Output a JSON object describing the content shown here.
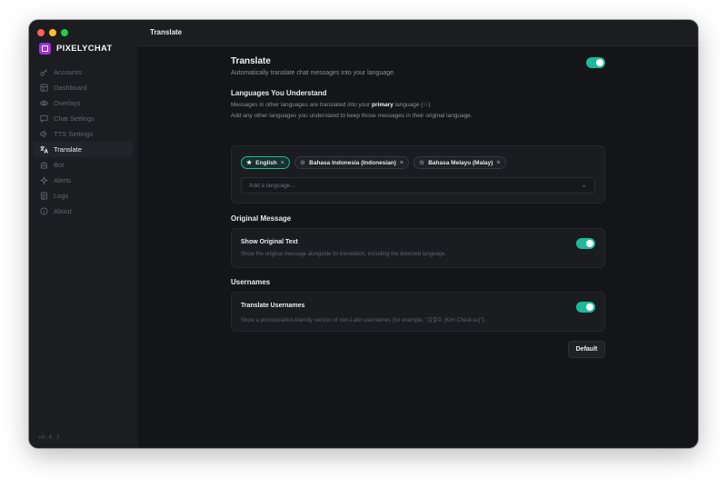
{
  "topbar": {
    "title": "Translate"
  },
  "brand": {
    "name": "PIXELYCHAT"
  },
  "sidebar": {
    "items": [
      {
        "label": "Accounts",
        "icon": "key-icon"
      },
      {
        "label": "Dashboard",
        "icon": "dashboard-icon"
      },
      {
        "label": "Overlays",
        "icon": "eye-icon"
      },
      {
        "label": "Chat Settings",
        "icon": "chat-bubble-icon"
      },
      {
        "label": "TTS Settings",
        "icon": "speaker-icon"
      },
      {
        "label": "Translate",
        "icon": "translate-icon",
        "active": true
      },
      {
        "label": "Bot",
        "icon": "bot-icon"
      },
      {
        "label": "Alerts",
        "icon": "sparkle-icon"
      },
      {
        "label": "Logs",
        "icon": "logs-icon"
      },
      {
        "label": "About",
        "icon": "info-icon"
      }
    ],
    "version": "v0.6.3"
  },
  "translate": {
    "title": "Translate",
    "description": "Automatically translate chat messages into your language.",
    "enabled": true
  },
  "languages": {
    "heading": "Languages You Understand",
    "line1_before": "Messages in other languages are translated into your ",
    "line1_bold": "primary",
    "line1_after": " language (☆).",
    "line2": "Add any other languages you understand to keep those messages in their original language.",
    "chips": [
      {
        "label": "English",
        "primary": true
      },
      {
        "label": "Bahasa Indonesia (Indonesian)",
        "primary": false
      },
      {
        "label": "Bahasa Melayu (Malay)",
        "primary": false
      }
    ],
    "add_placeholder": "Add a language..."
  },
  "original_message": {
    "heading": "Original Message",
    "title": "Show Original Text",
    "description": "Show the original message alongside its translation, including the detected language.",
    "enabled": true
  },
  "usernames": {
    "heading": "Usernames",
    "title": "Translate Usernames",
    "description": "Show a pronunciation-friendly version of non-Latin usernames (for example, \"김철수 (Kim Cheol-su)\").",
    "enabled": true
  },
  "buttons": {
    "default_label": "Default"
  },
  "colors": {
    "accent": "#1db999",
    "background": "#131518",
    "sidebar": "#1b1d21"
  }
}
